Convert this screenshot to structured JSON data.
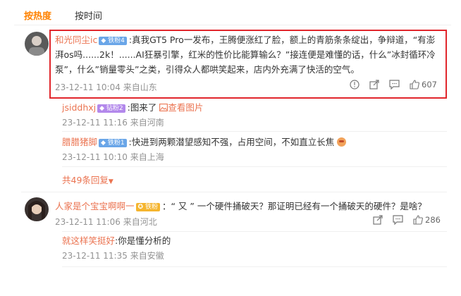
{
  "tabs": {
    "hot": "按热度",
    "time": "按时间"
  },
  "comments": [
    {
      "username": "和光同尘ic",
      "badge": "铁粉4",
      "text": ":真我GT5 Pro一发布，王腾便涨红了脸，额上的青筋条条绽出，争辩道，“有澎湃os吗......2k！......AI狂暴引擎，红米的性价比能算输么？”接连便是难懂的话，什么”冰封循环冷泵”，什么”销量零头”之类，引得众人都哄笑起来，店内外充满了快活的空气。",
      "time": "23-12-11 10:04",
      "location": "来自山东",
      "like_count": "607"
    },
    {
      "username": "人家是个宝宝啊啊一",
      "badge": "铁粉",
      "text": "：“ 又 ” 一个硬件捅破天？那证明已经有一个捅破天的硬件？是啥？",
      "time": "23-12-11 11:06",
      "location": "来自河北",
      "like_count": "286"
    }
  ],
  "replies": [
    {
      "username": "jsiddhxj",
      "badge": "钻粉2",
      "text": ":图来了",
      "link": "查看图片",
      "time": "23-12-11 11:16",
      "location": "来自河南"
    },
    {
      "username": "腊腊猪脚",
      "badge": "铁粉1",
      "text": ":快进到两颗潜望感知不强，占用空间，不如直立长焦",
      "time": "23-12-11 10:10",
      "location": "来自上海"
    },
    {
      "username": "就这样笑挺好",
      "text": ":你是懂分析的",
      "time": "23-12-11 11:35",
      "location": "来自安徽"
    }
  ],
  "more_replies": "共49条回复",
  "colors": {
    "accent": "#ff8200",
    "username": "#eb7350",
    "highlight": "#e1262c"
  },
  "icons": [
    "report-icon",
    "share-icon",
    "comment-icon",
    "like-icon",
    "chevron-down-icon",
    "image-icon",
    "emoji-icon",
    "medal-icon",
    "diamond-icon"
  ]
}
